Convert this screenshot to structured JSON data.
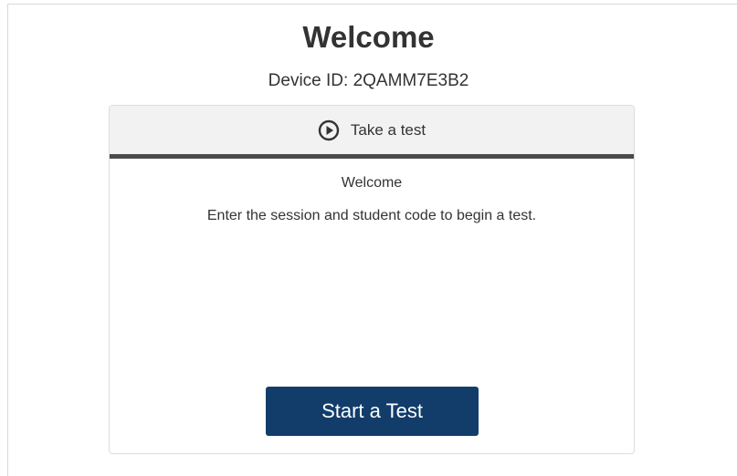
{
  "page": {
    "title": "Welcome",
    "device_id": "Device ID: 2QAMM7E3B2"
  },
  "card": {
    "header": {
      "icon": "play-circle-icon",
      "label": "Take a test"
    },
    "subtitle": "Welcome",
    "instruction": "Enter the session and student code to begin a test.",
    "start_button_label": "Start a Test"
  },
  "colors": {
    "button_bg": "#123d6a",
    "header_bg": "#f2f2f2",
    "header_border": "#4a4a4a",
    "text": "#333333"
  }
}
